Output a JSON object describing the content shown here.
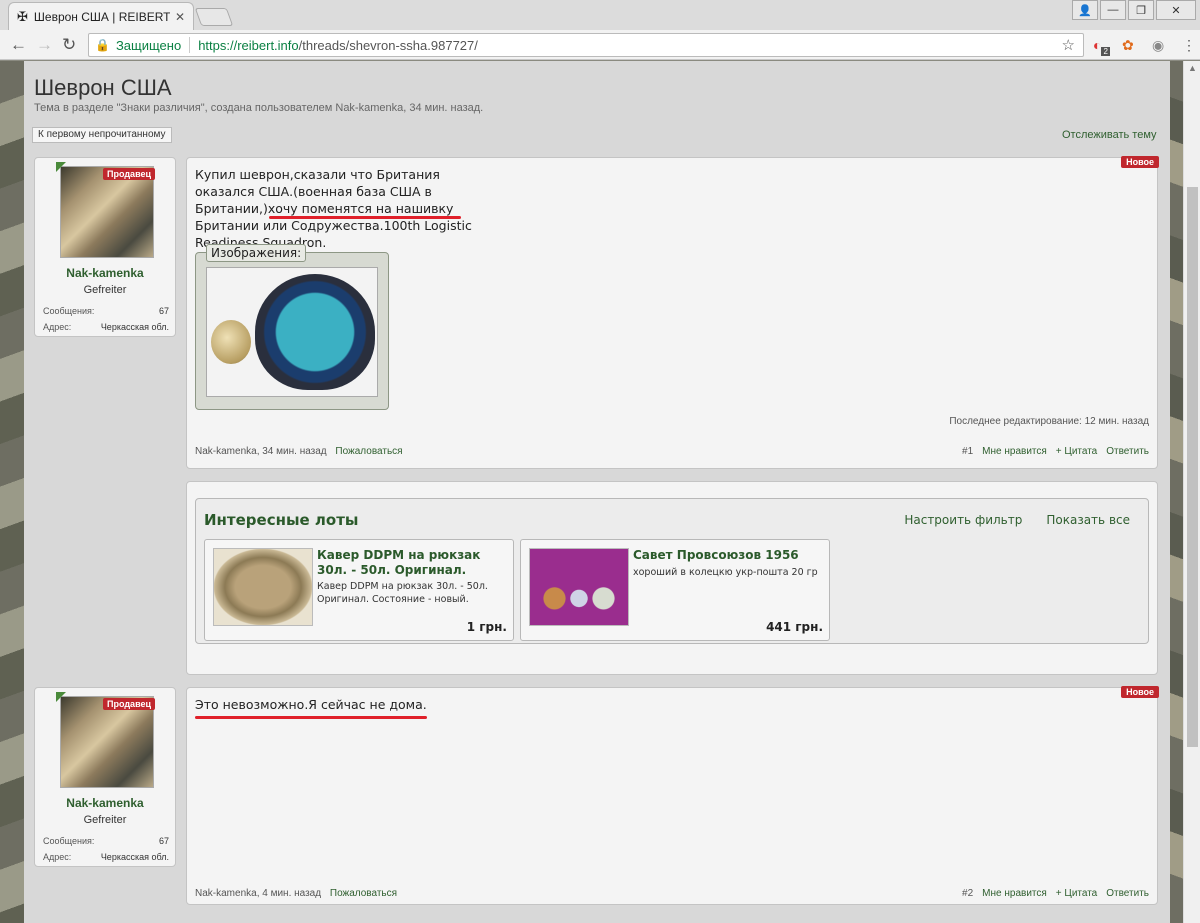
{
  "browser": {
    "tab_title": "Шеврон США | REIBERT.i",
    "secure_label": "Защищено",
    "url_scheme_host": "https://reibert.info",
    "url_path": "/threads/shevron-ssha.987727/",
    "ext_badge": "2"
  },
  "thread": {
    "title": "Шеврон США",
    "description": "Тема в разделе \"Знаки различия\", создана пользователем Nak-kamenka, 34 мин. назад.",
    "first_unread": "К первому непрочитанному",
    "watch": "Отслеживать тему"
  },
  "posts": [
    {
      "user": {
        "badge": "Продавец",
        "name": "Nak-kamenka",
        "rank": "Gefreiter",
        "messages_label": "Сообщения:",
        "messages_value": "67",
        "address_label": "Адрес:",
        "address_value": "Черкасская обл."
      },
      "new_badge": "Новое",
      "text_lines": [
        "Купил шеврон,сказали что Британия",
        "оказался США.(военная база США в",
        "Британии,)хочу поменятся на нашивку",
        "Британии или Содружества.100th Logistic",
        "Readiness Squadron."
      ],
      "attachments_label": "Изображения:",
      "edited": "Последнее редактирование: 12 мин. назад",
      "author_time": "Nak-kamenka, 34 мин. назад",
      "report": "Пожаловаться",
      "number": "#1",
      "like": "Мне нравится",
      "quote": "+ Цитата",
      "reply": "Ответить"
    },
    {
      "user": {
        "badge": "Продавец",
        "name": "Nak-kamenka",
        "rank": "Gefreiter",
        "messages_label": "Сообщения:",
        "messages_value": "67",
        "address_label": "Адрес:",
        "address_value": "Черкасская обл."
      },
      "new_badge": "Новое",
      "text": "Это невозможно.Я сейчас не дома.",
      "author_time": "Nak-kamenka, 4 мин. назад",
      "report": "Пожаловаться",
      "number": "#2",
      "like": "Мне нравится",
      "quote": "+ Цитата",
      "reply": "Ответить"
    }
  ],
  "lots": {
    "title": "Интересные лоты",
    "filter": "Настроить фильтр",
    "show_all": "Показать все",
    "items": [
      {
        "name": "Кавер DDPM на рюкзак 30л. - 50л. Оригинал.",
        "desc": "Кавер DDPM на рюкзак 30л. - 50л. Оригинал. Состояние - новый.",
        "price": "1 грн."
      },
      {
        "name": "Савет Провсоюзов 1956",
        "desc": "хороший в колецкю укр-пошта 20 гр",
        "price": "441 грн."
      }
    ]
  }
}
